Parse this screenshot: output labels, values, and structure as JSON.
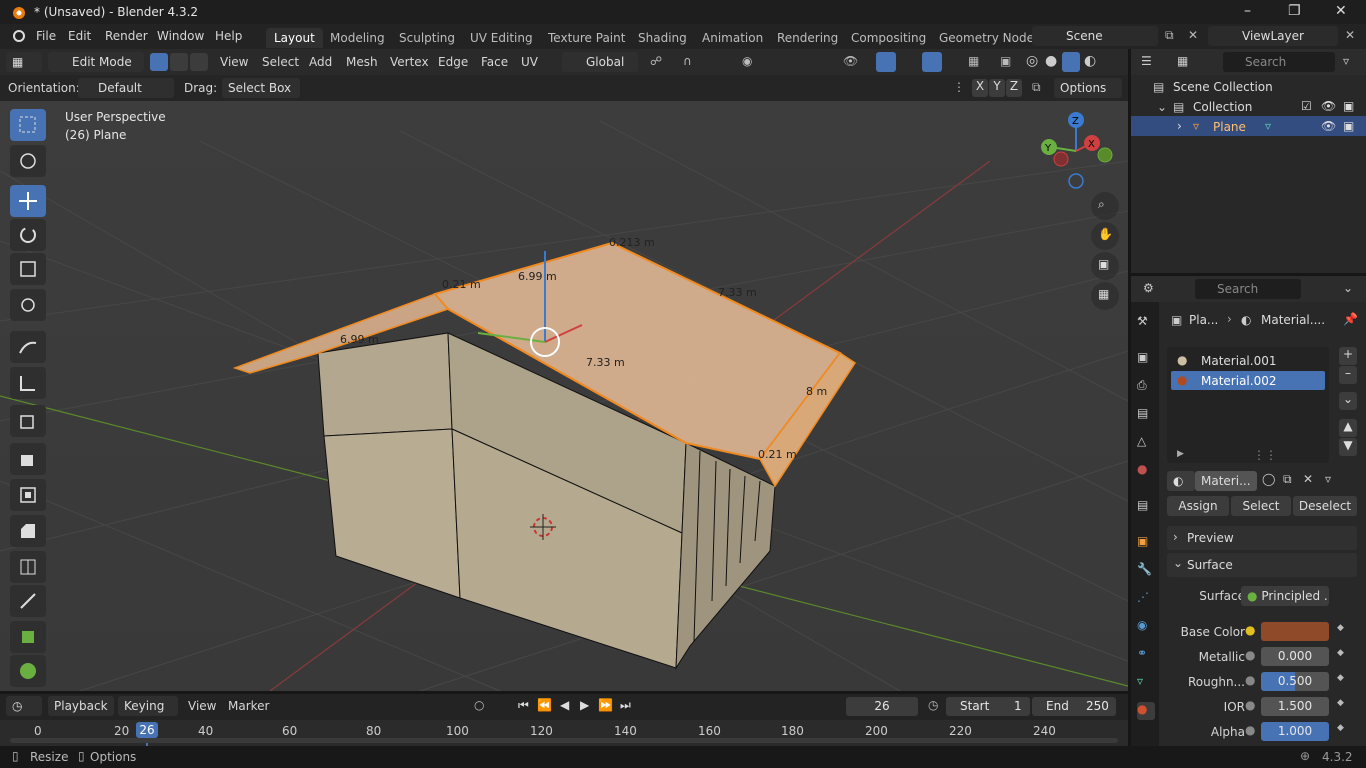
{
  "window": {
    "title": "* (Unsaved) - Blender 4.3.2"
  },
  "menu": {
    "items": [
      "File",
      "Edit",
      "Render",
      "Window",
      "Help"
    ]
  },
  "workspaces": [
    "Layout",
    "Modeling",
    "Sculpting",
    "UV Editing",
    "Texture Paint",
    "Shading",
    "Animation",
    "Rendering",
    "Compositing",
    "Geometry Node"
  ],
  "scene": {
    "name": "Scene",
    "view_layer": "ViewLayer"
  },
  "viewport_header": {
    "mode": "Edit Mode",
    "menus": [
      "View",
      "Select",
      "Add",
      "Mesh",
      "Vertex",
      "Edge",
      "Face",
      "UV"
    ],
    "transform": "Global"
  },
  "tool_settings": {
    "orientation_label": "Orientation:",
    "orientation_value": "Default",
    "drag_label": "Drag:",
    "drag_value": "Select Box",
    "axes": [
      "X",
      "Y",
      "Z"
    ],
    "options": "Options"
  },
  "overlay": {
    "perspective": "User Perspective",
    "object": "(26) Plane"
  },
  "measurements": {
    "a": "0.213 m",
    "b": "6.99 m",
    "c": "7.33 m",
    "d": "7.33 m",
    "e": "8 m",
    "f": "0.21 m",
    "g": "6.99 m",
    "h": "0.21 m"
  },
  "outliner": {
    "search": "Search",
    "scene_collection": "Scene Collection",
    "collection": "Collection",
    "object": "Plane"
  },
  "properties": {
    "search": "Search",
    "breadcrumb_obj": "Pla...",
    "breadcrumb_mat": "Material....",
    "slots": [
      "Material.001",
      "Material.002"
    ],
    "material_field": "Materi...",
    "assign": "Assign",
    "select": "Select",
    "deselect": "Deselect",
    "preview": "Preview",
    "surface_panel": "Surface",
    "surface_label": "Surface",
    "surface_value": "Principled ...",
    "base_color_label": "Base Color",
    "base_color": "#8f4a2a",
    "metallic_label": "Metallic",
    "metallic": "0.000",
    "roughness_label": "Roughn...",
    "roughness": "0.500",
    "ior_label": "IOR",
    "ior": "1.500",
    "alpha_label": "Alpha",
    "alpha": "1.000"
  },
  "timeline": {
    "menus": [
      "Playback",
      "Keying",
      "View",
      "Marker"
    ],
    "current_frame": "26",
    "start_label": "Start",
    "start": "1",
    "end_label": "End",
    "end": "250",
    "ruler": [
      "0",
      "20",
      "26",
      "40",
      "60",
      "80",
      "100",
      "120",
      "140",
      "160",
      "180",
      "200",
      "220",
      "240"
    ]
  },
  "status": {
    "resize": "Resize",
    "options": "Options",
    "version": "4.3.2"
  }
}
